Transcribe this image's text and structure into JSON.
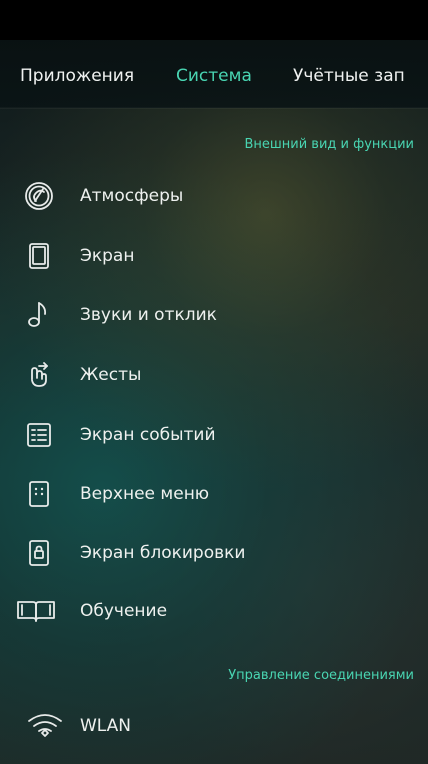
{
  "header": {
    "tabs": [
      {
        "label": "Приложения",
        "active": false
      },
      {
        "label": "Система",
        "active": true
      },
      {
        "label": "Учётные зап",
        "active": false
      }
    ]
  },
  "sections": {
    "appearance": "Внешний вид и функции",
    "connections": "Управление соединениями"
  },
  "menu": {
    "items": [
      {
        "label": "Атмосферы",
        "icon": "atmosphere-icon"
      },
      {
        "label": "Экран",
        "icon": "screen-icon"
      },
      {
        "label": "Звуки и отклик",
        "icon": "music-note-icon"
      },
      {
        "label": "Жесты",
        "icon": "gesture-icon"
      },
      {
        "label": "Экран событий",
        "icon": "events-screen-icon"
      },
      {
        "label": "Верхнее меню",
        "icon": "top-menu-icon"
      },
      {
        "label": "Экран блокировки",
        "icon": "lock-screen-icon"
      },
      {
        "label": "Обучение",
        "icon": "book-icon"
      },
      {
        "label": "WLAN",
        "icon": "wifi-icon"
      }
    ]
  },
  "colors": {
    "accent": "#49d5b2",
    "text": "#eef1ef"
  }
}
